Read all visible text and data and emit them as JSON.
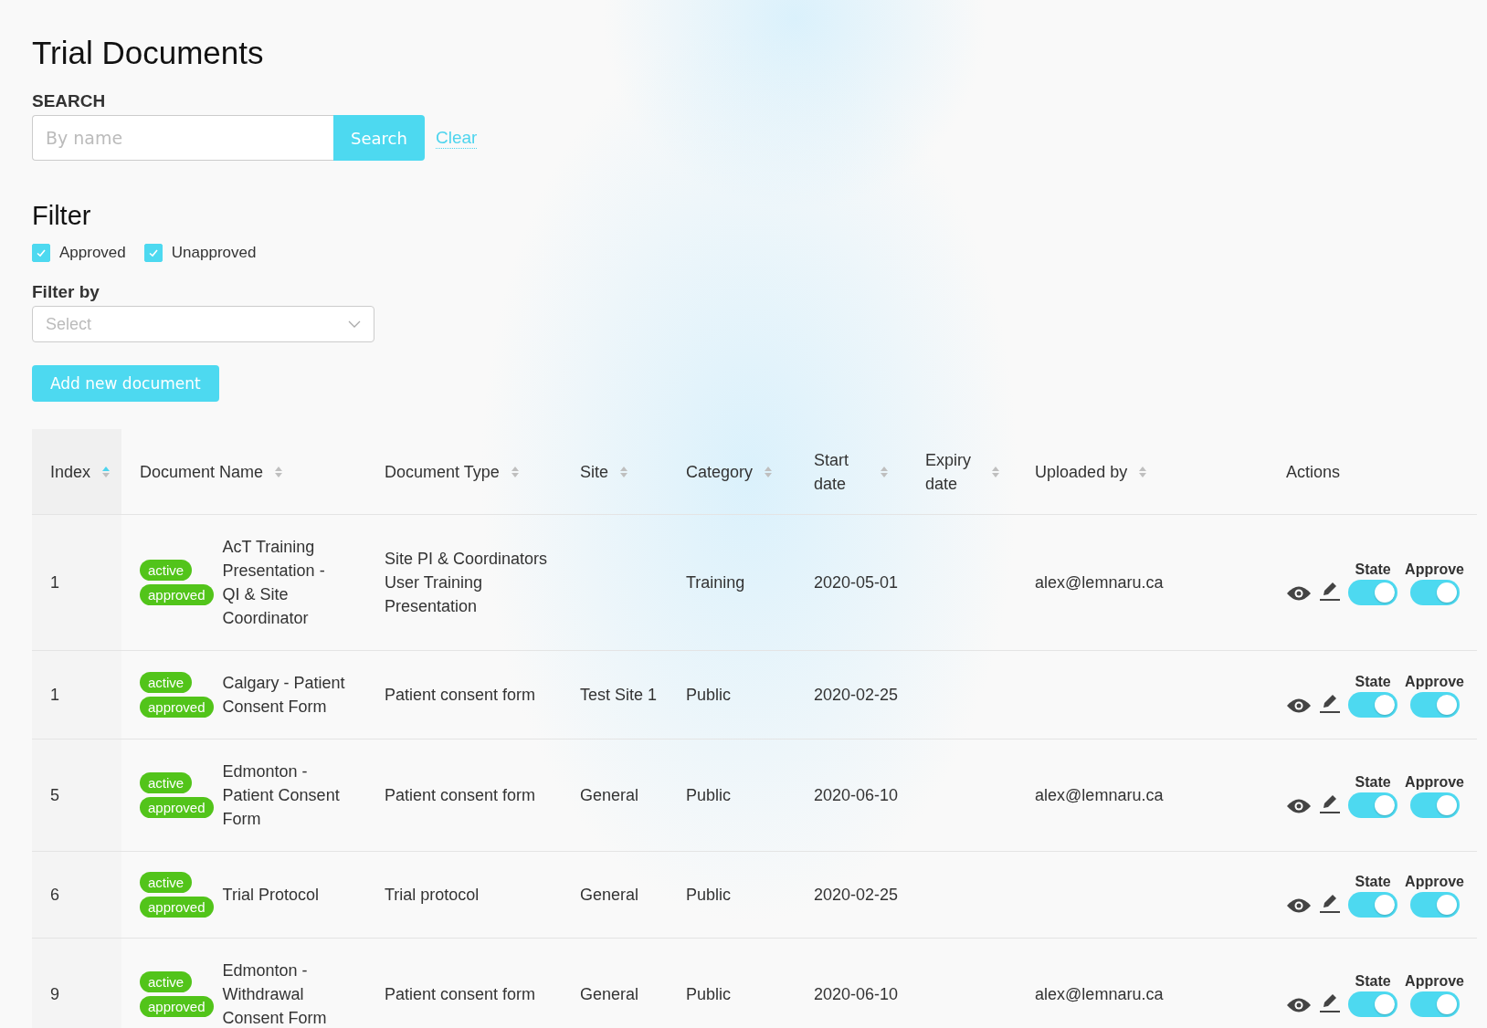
{
  "title": "Trial Documents",
  "search": {
    "label": "SEARCH",
    "placeholder": "By name",
    "button": "Search",
    "clear": "Clear"
  },
  "filter": {
    "heading": "Filter",
    "checkboxes": [
      {
        "label": "Approved",
        "checked": true
      },
      {
        "label": "Unapproved",
        "checked": true
      }
    ],
    "filter_by": {
      "label": "Filter by",
      "placeholder": "Select"
    }
  },
  "add_button": "Add new document",
  "table": {
    "columns": [
      {
        "label": "Index",
        "sorted_asc": true
      },
      {
        "label": "Document Name",
        "sorted_asc": false
      },
      {
        "label": "Document Type",
        "sorted_asc": false
      },
      {
        "label": "Site",
        "sorted_asc": false
      },
      {
        "label": "Category",
        "sorted_asc": false
      },
      {
        "label": "Start date",
        "sorted_asc": false
      },
      {
        "label": "Expiry date",
        "sorted_asc": false
      },
      {
        "label": "Uploaded by",
        "sorted_asc": false
      },
      {
        "label": "Actions"
      }
    ],
    "rows": [
      {
        "index": "1",
        "tags": [
          "active",
          "approved"
        ],
        "name": "AcT Training Presentation - QI & Site Coordinator",
        "type": "Site PI & Coordinators User Training Presentation",
        "site": "",
        "category": "Training",
        "start": "2020-05-01",
        "uploaded_by": "alex@lemnaru.ca",
        "state_label": "State",
        "state_on": true,
        "approve_label": "Approve",
        "approve_on": true
      },
      {
        "index": "1",
        "tags": [
          "active",
          "approved"
        ],
        "name": "Calgary - Patient Consent Form",
        "type": "Patient consent form",
        "site": "Test Site 1",
        "category": "Public",
        "start": "2020-02-25",
        "uploaded_by": "",
        "state_label": "State",
        "state_on": true,
        "approve_label": "Approve",
        "approve_on": true
      },
      {
        "index": "5",
        "tags": [
          "active",
          "approved"
        ],
        "name": "Edmonton - Patient Consent Form",
        "type": "Patient consent form",
        "site": "General",
        "category": "Public",
        "start": "2020-06-10",
        "uploaded_by": "alex@lemnaru.ca",
        "state_label": "State",
        "state_on": true,
        "approve_label": "Approve",
        "approve_on": true
      },
      {
        "index": "6",
        "tags": [
          "active",
          "approved"
        ],
        "name": "Trial Protocol",
        "type": "Trial protocol",
        "site": "General",
        "category": "Public",
        "start": "2020-02-25",
        "uploaded_by": "",
        "state_label": "State",
        "state_on": true,
        "approve_label": "Approve",
        "approve_on": true
      },
      {
        "index": "9",
        "tags": [
          "active",
          "approved"
        ],
        "name": "Edmonton - Withdrawal Consent Form",
        "type": "Patient consent form",
        "site": "General",
        "category": "Public",
        "start": "2020-06-10",
        "uploaded_by": "alex@lemnaru.ca",
        "state_label": "State",
        "state_on": true,
        "approve_label": "Approve",
        "approve_on": true
      }
    ]
  }
}
